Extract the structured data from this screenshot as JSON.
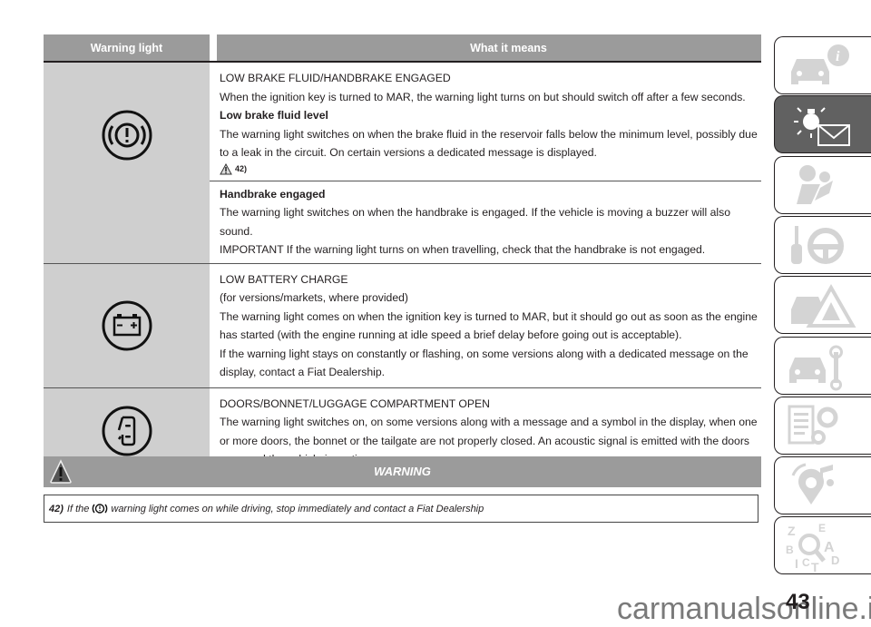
{
  "table": {
    "headers": {
      "warning_light": "Warning light",
      "what_it_means": "What it means"
    },
    "rows": [
      {
        "icon": "brake-warning-icon",
        "sections": [
          {
            "title": "LOW BRAKE FLUID/HANDBRAKE ENGAGED",
            "title_bold": false,
            "text": "When the ignition key is turned to MAR, the warning light turns on but should switch off after a few seconds."
          },
          {
            "title": "Low brake fluid level",
            "title_bold": true,
            "text": "The warning light switches on when the brake fluid in the reservoir falls below the minimum level, possibly due to a leak in the circuit. On certain versions a dedicated message is displayed.",
            "ref": "42)"
          },
          {
            "title": "Handbrake engaged",
            "title_bold": true,
            "text": "The warning light switches on when the handbrake is engaged. If the vehicle is moving a buzzer will also sound.",
            "text2": "IMPORTANT If the warning light turns on when travelling, check that the handbrake is not engaged."
          }
        ]
      },
      {
        "icon": "battery-icon",
        "title": "LOW BATTERY CHARGE",
        "lines": [
          "(for versions/markets, where provided)",
          "The warning light comes on when the ignition key is turned to MAR, but it should go out as soon as the engine has started (with the engine running at idle speed a brief delay before going out is acceptable).",
          "If the warning light stays on constantly or flashing, on some versions along with a dedicated message on the display, contact a Fiat Dealership."
        ]
      },
      {
        "icon": "door-open-icon",
        "title": "DOORS/BONNET/LUGGAGE COMPARTMENT OPEN",
        "lines": [
          "The warning light switches on, on some versions along with a message and a symbol in the display, when one or more doors, the bonnet or the tailgate are not properly closed. An acoustic signal is emitted with the doors open and the vehicle in motion."
        ]
      }
    ]
  },
  "warning": {
    "title": "WARNING",
    "note_number": "42)",
    "note_prefix": "If the",
    "note_text": "warning light comes on while driving, stop immediately and contact a Fiat Dealership"
  },
  "sidebar": {
    "tabs": [
      {
        "name": "car-info",
        "active": false
      },
      {
        "name": "warning-lights-messages",
        "active": true
      },
      {
        "name": "safety-airbag",
        "active": false
      },
      {
        "name": "starting-driving",
        "active": false
      },
      {
        "name": "emergency",
        "active": false
      },
      {
        "name": "maintenance",
        "active": false
      },
      {
        "name": "technical-data",
        "active": false
      },
      {
        "name": "multimedia",
        "active": false
      },
      {
        "name": "index",
        "active": false
      }
    ]
  },
  "page_number": "43",
  "watermark": "carmanualsonline.info",
  "colors": {
    "header_gray": "#9b9b9b",
    "icon_cell_gray": "#cfcfcf",
    "active_tab": "#616161",
    "tab_icon_gray": "#d4d4d4"
  }
}
